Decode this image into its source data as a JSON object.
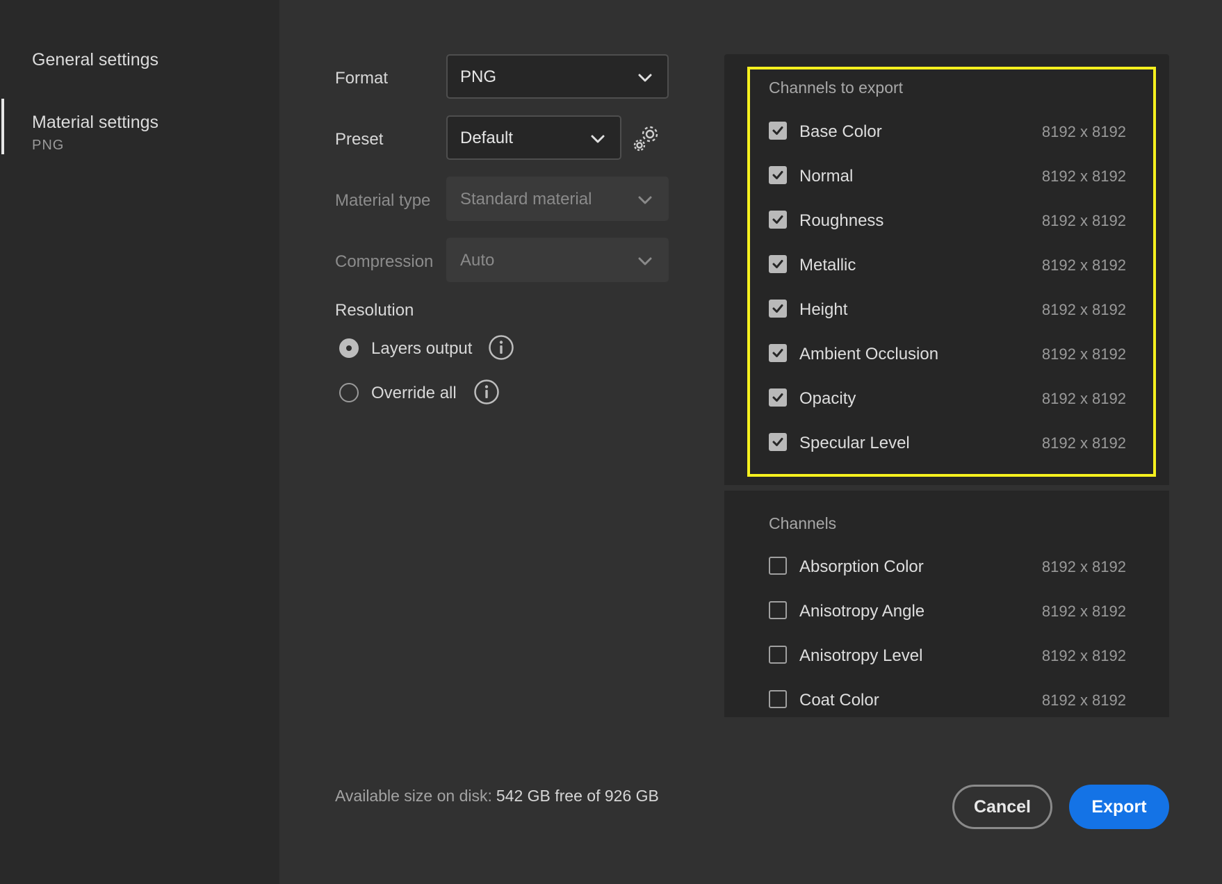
{
  "sidebar": {
    "items": [
      {
        "label": "General settings"
      },
      {
        "label": "Material settings",
        "sublabel": "PNG"
      }
    ]
  },
  "form": {
    "format": {
      "label": "Format",
      "value": "PNG"
    },
    "preset": {
      "label": "Preset",
      "value": "Default"
    },
    "material_type": {
      "label": "Material type",
      "value": "Standard material"
    },
    "compression": {
      "label": "Compression",
      "value": "Auto"
    },
    "resolution": {
      "label": "Resolution",
      "options": [
        {
          "label": "Layers output",
          "checked": true
        },
        {
          "label": "Override all",
          "checked": false
        }
      ]
    }
  },
  "channels_to_export": {
    "title": "Channels to export",
    "items": [
      {
        "name": "Base Color",
        "resolution": "8192 x 8192",
        "checked": true
      },
      {
        "name": "Normal",
        "resolution": "8192 x 8192",
        "checked": true
      },
      {
        "name": "Roughness",
        "resolution": "8192 x 8192",
        "checked": true
      },
      {
        "name": "Metallic",
        "resolution": "8192 x 8192",
        "checked": true
      },
      {
        "name": "Height",
        "resolution": "8192 x 8192",
        "checked": true
      },
      {
        "name": "Ambient Occlusion",
        "resolution": "8192 x 8192",
        "checked": true
      },
      {
        "name": "Opacity",
        "resolution": "8192 x 8192",
        "checked": true
      },
      {
        "name": "Specular Level",
        "resolution": "8192 x 8192",
        "checked": true
      }
    ]
  },
  "channels": {
    "title": "Channels",
    "items": [
      {
        "name": "Absorption Color",
        "resolution": "8192 x 8192",
        "checked": false
      },
      {
        "name": "Anisotropy Angle",
        "resolution": "8192 x 8192",
        "checked": false
      },
      {
        "name": "Anisotropy Level",
        "resolution": "8192 x 8192",
        "checked": false
      },
      {
        "name": "Coat Color",
        "resolution": "8192 x 8192",
        "checked": false
      }
    ]
  },
  "footer": {
    "disk_label": "Available size on disk:",
    "disk_value": "542 GB free of 926 GB",
    "cancel_label": "Cancel",
    "export_label": "Export"
  },
  "colors": {
    "accent": "#1473e6",
    "highlight": "#f5f01e",
    "background": "#313131",
    "sidebar": "#292929"
  },
  "icons": {
    "dropdown": "chevron-down-icon",
    "preset_settings": "gear-icon",
    "info": "info-icon",
    "checkbox_checked": "checkmark-icon"
  }
}
